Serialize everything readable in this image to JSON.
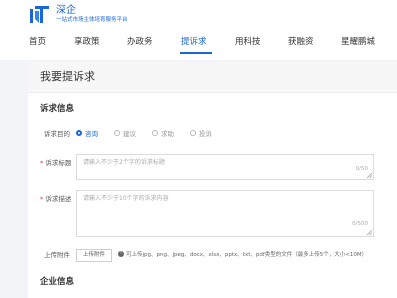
{
  "brand": {
    "name": "深企",
    "slogan": "一站式市场主体培育服务平台"
  },
  "nav": {
    "items": [
      {
        "label": "首页"
      },
      {
        "label": "享政策"
      },
      {
        "label": "办政务"
      },
      {
        "label": "提诉求"
      },
      {
        "label": "用科技"
      },
      {
        "label": "获融资"
      },
      {
        "label": "星耀鹏城"
      }
    ],
    "active": "提诉求"
  },
  "page": {
    "title": "我要提诉求"
  },
  "appeal_info": {
    "section_title": "诉求信息",
    "purpose": {
      "label": "诉求目的",
      "options": [
        "咨询",
        "建议",
        "求助",
        "投诉"
      ],
      "selected": "咨询"
    },
    "title_field": {
      "required_mark": "*",
      "label": "诉求标题",
      "placeholder": "请输入不少于2个字的诉求标题",
      "counter": "0/50"
    },
    "description_field": {
      "required_mark": "*",
      "label": "诉求描述",
      "placeholder": "请输入不少于10个字的诉求内容",
      "counter": "0/500"
    },
    "attachment": {
      "label": "上传附件",
      "button": "上传附件",
      "hint": "可上传jpg、png、jpeg、docx、xlsx、pptx、txt、pdf类型的文件（最多上传5个，大小<10M）"
    }
  },
  "enterprise_info": {
    "section_title": "企业信息"
  },
  "colors": {
    "accent": "#1a66d9",
    "background": "#f2f4f7",
    "required": "#e33333"
  }
}
